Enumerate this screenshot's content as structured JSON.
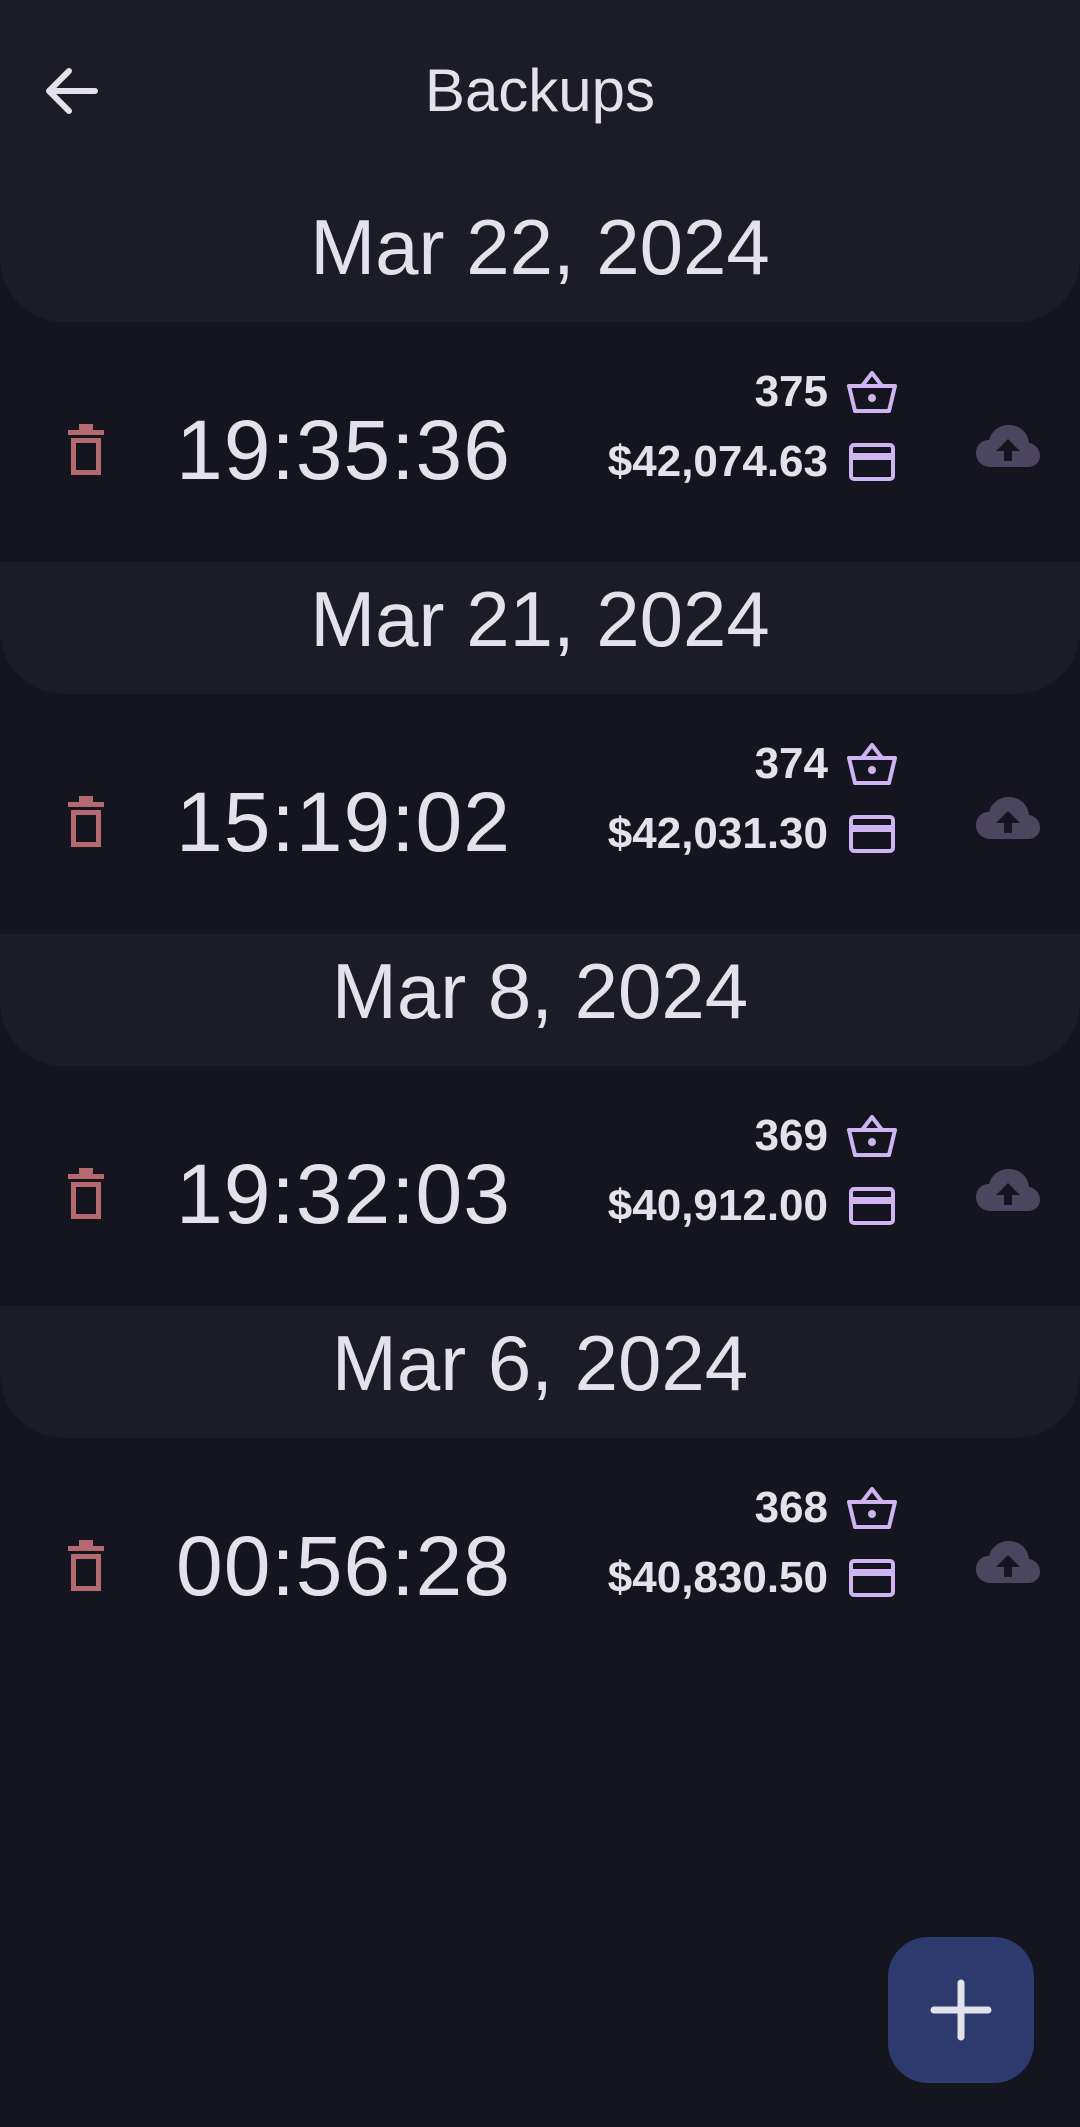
{
  "header": {
    "title": "Backups",
    "back_icon": "arrow-left-icon"
  },
  "colors": {
    "background": "#14151f",
    "header_surface": "#1b1c28",
    "text": "#e3e2ec",
    "delete": "#b56a70",
    "accent": "#cfb4f2",
    "upload": "#4c4560",
    "fab": "#2c3a6e"
  },
  "groups": [
    {
      "date": "Mar 22, 2024",
      "time": "19:35:36",
      "count": "375",
      "total": "$42,074.63"
    },
    {
      "date": "Mar 21, 2024",
      "time": "15:19:02",
      "count": "374",
      "total": "$42,031.30"
    },
    {
      "date": "Mar 8, 2024",
      "time": "19:32:03",
      "count": "369",
      "total": "$40,912.00"
    },
    {
      "date": "Mar 6, 2024",
      "time": "00:56:28",
      "count": "368",
      "total": "$40,830.50"
    }
  ],
  "row_icons": {
    "delete": "trash-icon",
    "count": "basket-icon",
    "total": "credit-card-icon",
    "upload": "cloud-upload-icon"
  },
  "fab": {
    "icon": "plus-icon"
  }
}
